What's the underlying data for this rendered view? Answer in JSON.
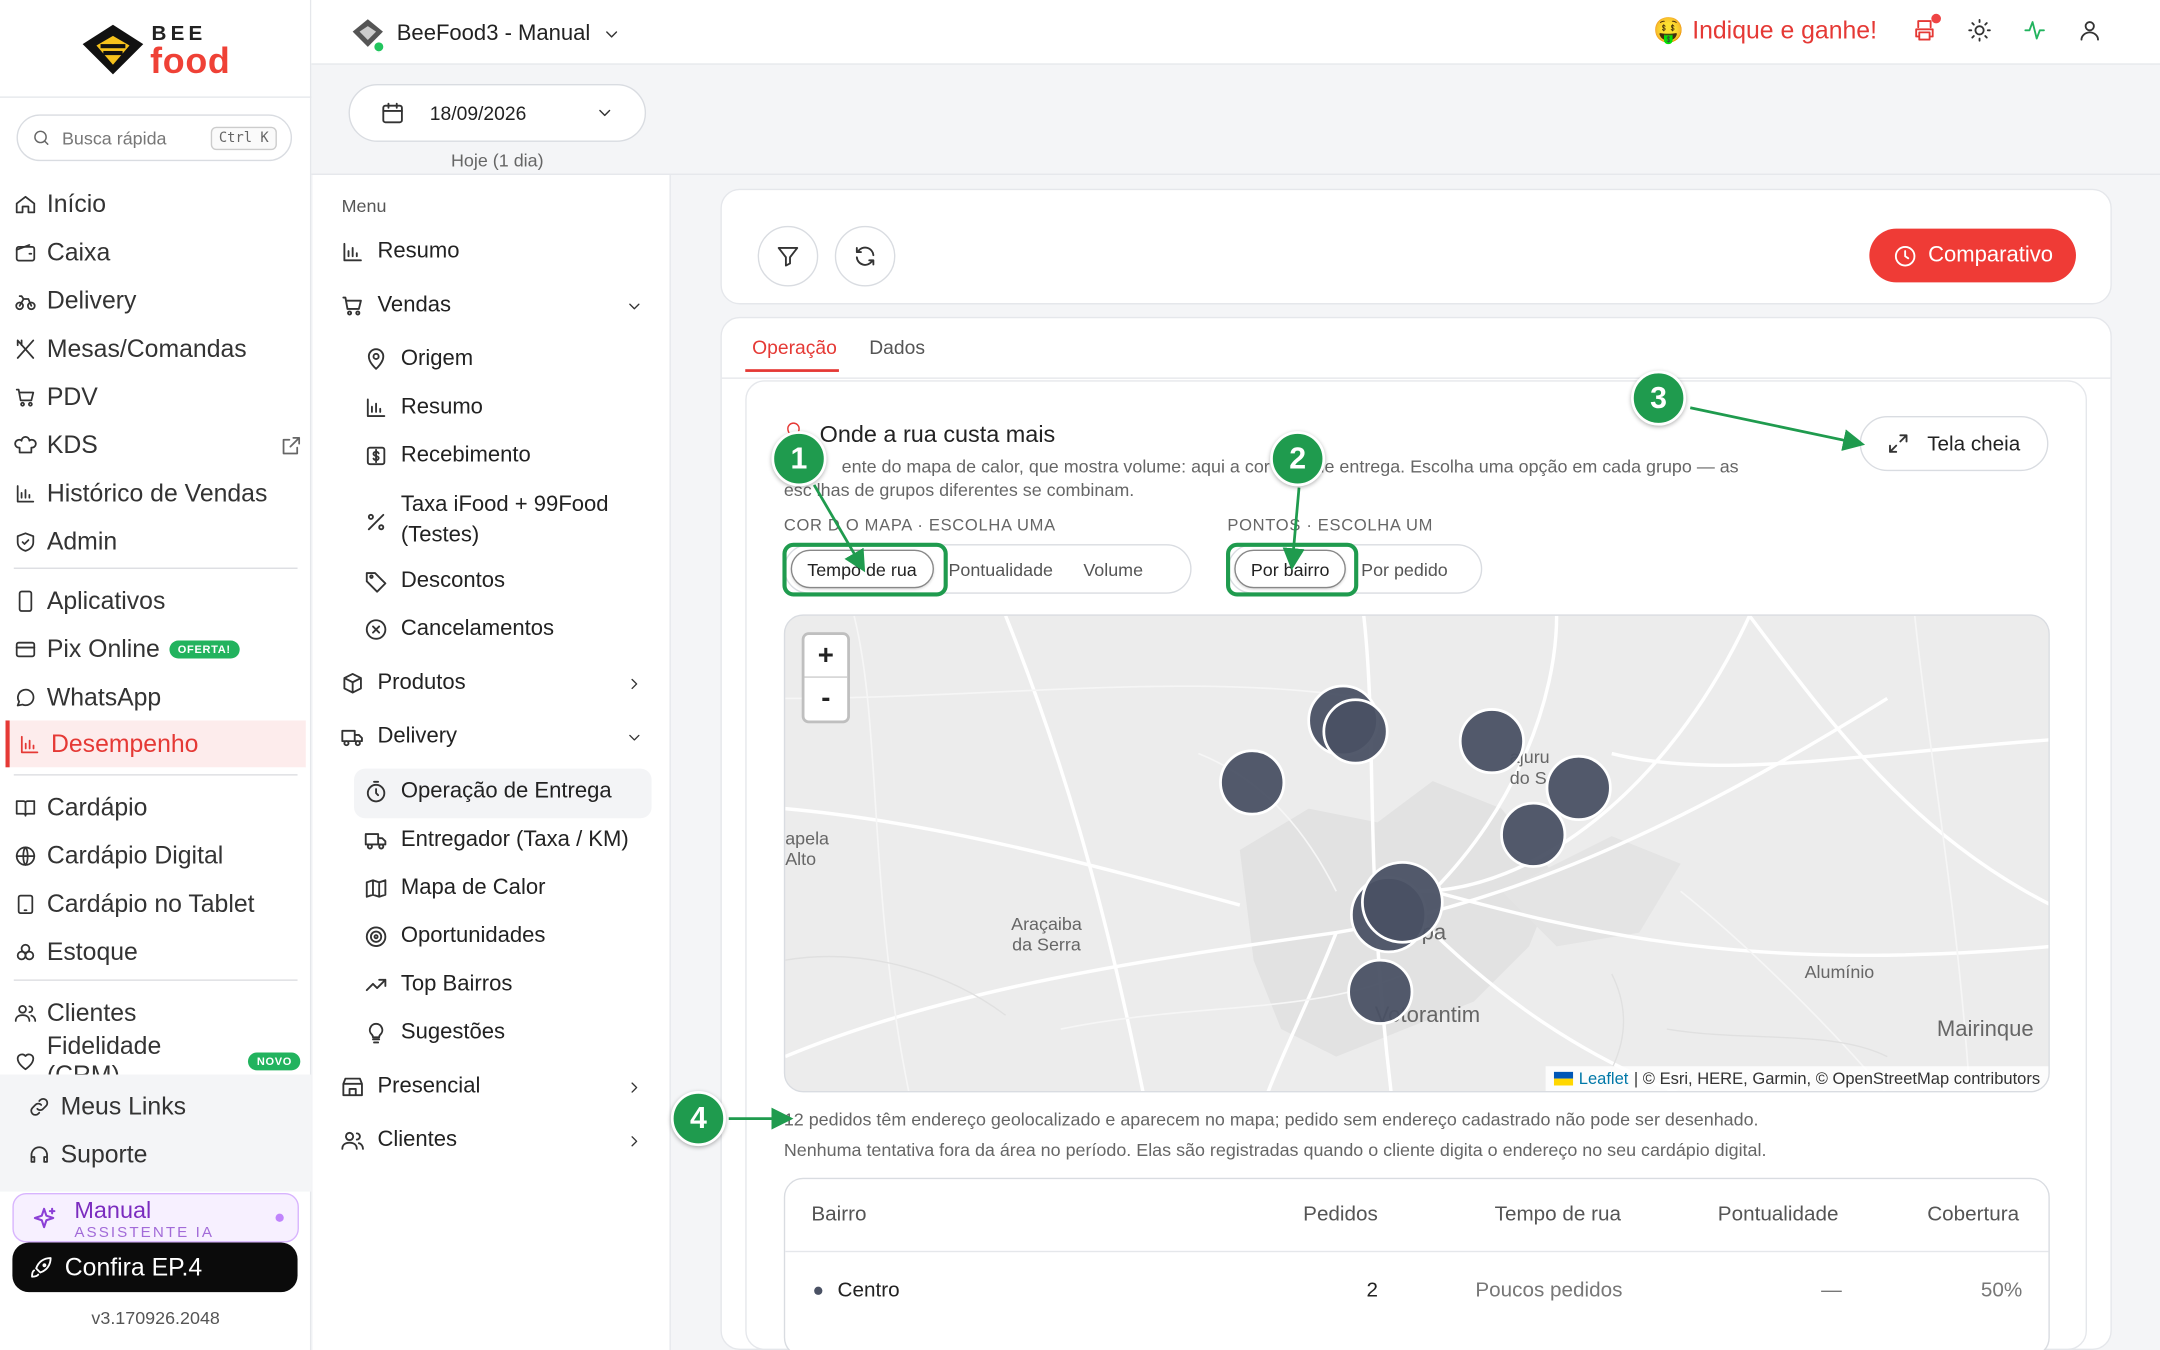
{
  "brand": {
    "top": "BEE",
    "bottom": "food"
  },
  "search": {
    "placeholder": "Busca rápida",
    "shortcut": "Ctrl K"
  },
  "nav": [
    {
      "label": "Início",
      "icon": "home-icon"
    },
    {
      "label": "Caixa",
      "icon": "wallet-icon"
    },
    {
      "label": "Delivery",
      "icon": "bike-icon"
    },
    {
      "label": "Mesas/Comandas",
      "icon": "utensils-icon"
    },
    {
      "label": "PDV",
      "icon": "cart-icon"
    },
    {
      "label": "KDS",
      "icon": "chef-hat-icon"
    },
    {
      "label": "Histórico de Vendas",
      "icon": "bar-chart-icon"
    },
    {
      "label": "Admin",
      "icon": "shield-icon"
    },
    {
      "label": "Aplicativos",
      "icon": "smartphone-icon"
    },
    {
      "label": "Pix Online",
      "icon": "credit-card-icon",
      "badge": "OFERTA!"
    },
    {
      "label": "WhatsApp",
      "icon": "chat-icon"
    },
    {
      "label": "Desempenho",
      "icon": "bar-chart-icon"
    },
    {
      "label": "Cardápio",
      "icon": "book-icon"
    },
    {
      "label": "Cardápio Digital",
      "icon": "globe-icon"
    },
    {
      "label": "Cardápio no Tablet",
      "icon": "tablet-icon"
    },
    {
      "label": "Estoque",
      "icon": "boxes-icon"
    },
    {
      "label": "Clientes",
      "icon": "users-icon"
    },
    {
      "label": "Fidelidade (CRM)",
      "icon": "heart-icon",
      "badge": "NOVO"
    },
    {
      "label": "Meus Links",
      "icon": "link-icon"
    },
    {
      "label": "Suporte",
      "icon": "headset-icon"
    }
  ],
  "assistant": {
    "title": "Manual",
    "subtitle": "ASSISTENTE IA"
  },
  "promo": {
    "label": "Confira EP.4"
  },
  "version": "v3.170926.2048",
  "topbar": {
    "tenant": "BeeFood3 - Manual",
    "referral": "Indique e ganhe!",
    "referral_emoji": "🤑"
  },
  "date": {
    "value": "18/09/2026",
    "caption": "Hoje (1 dia)"
  },
  "submenu": {
    "title": "Menu",
    "items": [
      "Resumo",
      "Vendas",
      "Origem",
      "Resumo",
      "Recebimento",
      "Taxa iFood + 99Food",
      "(Testes)",
      "Descontos",
      "Cancelamentos",
      "Produtos",
      "Delivery",
      "Operação de Entrega",
      "Entregador (Taxa / KM)",
      "Mapa de Calor",
      "Oportunidades",
      "Top Bairros",
      "Sugestões",
      "Presencial",
      "Clientes"
    ]
  },
  "toolbar": {
    "compare_label": "Comparativo"
  },
  "tabs": {
    "operation": "Operação",
    "data": "Dados"
  },
  "section": {
    "title": "Onde a rua custa mais",
    "desc_line1": "ente do mapa de calor, que mostra volume: aqui a cor      mpo de entrega. Escolha uma opção em cada grupo — as",
    "desc_line2": "esc lhas de grupos diferentes se combinam.",
    "fullscreen_label": "Tela cheia"
  },
  "color_group": {
    "label": "COR D O MAPA · ESCOLHA UMA",
    "options": [
      "Tempo de rua",
      "Pontualidade",
      "Volume"
    ],
    "selected": "Tempo de rua"
  },
  "points_group": {
    "label": "PONTOS · ESCOLHA UM",
    "options": [
      "Por bairro",
      "Por pedido"
    ],
    "selected": "Por bairro"
  },
  "map": {
    "zoom_in": "+",
    "zoom_out": "-",
    "labels": [
      "apela",
      "Alto",
      "Araçaiba",
      "da Serra",
      "ajuru",
      "do S",
      "pa",
      "Votorantim",
      "Alumínio",
      "Mairinque"
    ],
    "attribution_link": "Leaflet",
    "attribution_rest": "| © Esri, HERE, Garmin, © OpenStreetMap contributors"
  },
  "footnote": {
    "line1": "12 pedidos têm endereço geolocalizado e aparecem no mapa; pedido sem endereço cadastrado não pode ser desenhado.",
    "line2": "Nenhuma tentativa fora da área no período. Elas são registradas quando o cliente digita o endereço no seu cardápio digital."
  },
  "table": {
    "headers": [
      "Bairro",
      "Pedidos",
      "Tempo de rua",
      "Pontualidade",
      "Cobertura"
    ],
    "rows": [
      {
        "bairro": "Centro",
        "pedidos": "2",
        "tempo": "Poucos pedidos",
        "pontualidade": "—",
        "cobertura": "50%"
      }
    ]
  },
  "annotations": [
    "1",
    "2",
    "3",
    "4"
  ],
  "colors": {
    "accent": "#ef3b36",
    "annotation": "#1f9b4e",
    "marker": "#4a5164"
  }
}
